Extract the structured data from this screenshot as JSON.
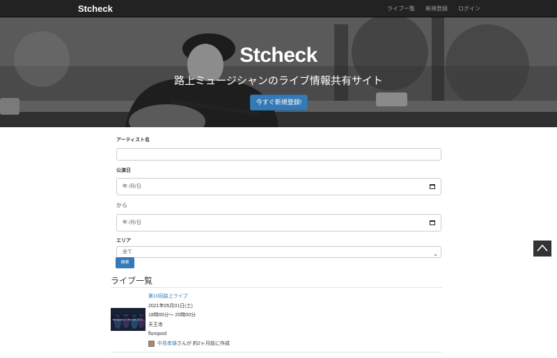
{
  "nav": {
    "brand": "Stcheck",
    "links": [
      "ライブ一覧",
      "新規登録",
      "ログイン"
    ]
  },
  "hero": {
    "title": "Stcheck",
    "subtitle": "路上ミュージシャンのライブ情報共有サイト",
    "cta": "今すぐ新規登録!"
  },
  "form": {
    "artist_label": "アーティスト名",
    "artist_value": "",
    "date_label": "公演日",
    "date_from_placeholder": "年 /月/日",
    "kara": "から",
    "date_to_placeholder": "年 /月/日",
    "area_label": "エリア",
    "area_selected": "全て",
    "search_button": "検索"
  },
  "list": {
    "heading": "ライブ一覧",
    "items": [
      {
        "title": "第10回路上ライブ",
        "date": "2021年05月01日(土)",
        "time": "18時00分～ 20時00分",
        "place": "天王寺",
        "artist": "flumpool",
        "author_name": "中島孝雄",
        "author_suffix": "さんが 約2ヶ月前に作成",
        "thumb_text": "flumpool In the hall 2021"
      }
    ]
  },
  "icons": {
    "calendar": "calendar-icon",
    "chevron": "chevron-down-icon",
    "back_to_top": "chevron-up-icon"
  },
  "colors": {
    "navbar": "#222222",
    "primary": "#337ab7"
  }
}
